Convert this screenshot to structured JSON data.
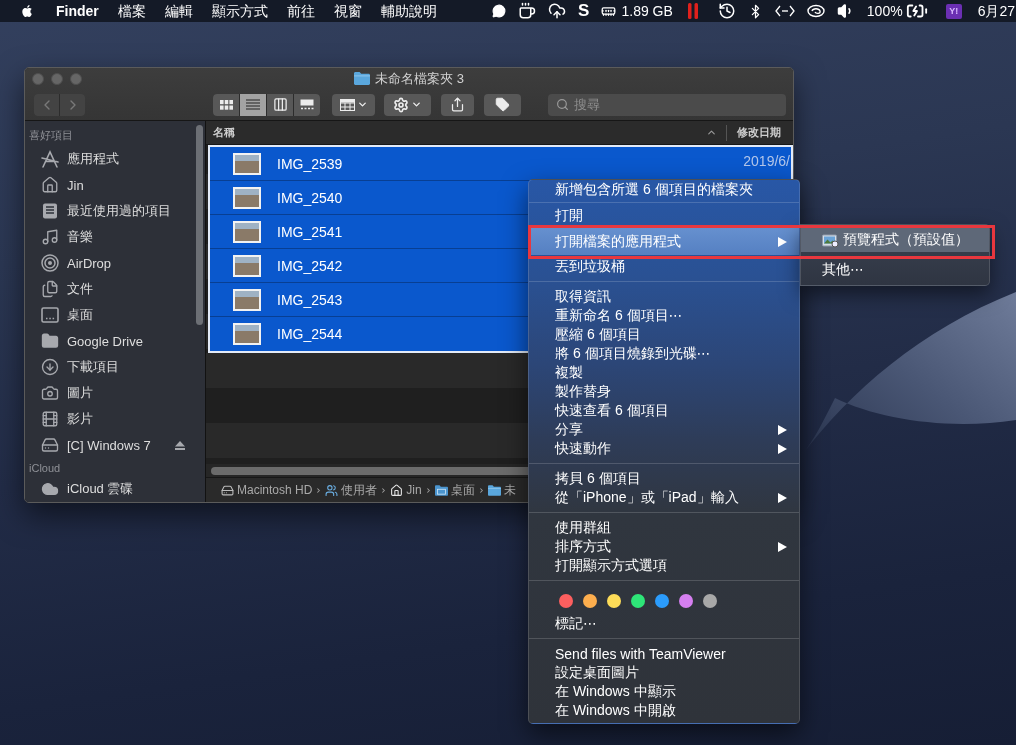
{
  "menu_bar": {
    "app_name": "Finder",
    "menus": [
      "檔案",
      "編輯",
      "顯示方式",
      "前往",
      "視窗",
      "輔助說明"
    ],
    "status": {
      "letter_logo": "S",
      "memory": "1.89 GB",
      "battery": "100%",
      "badge": "Y!",
      "date": "6月27"
    }
  },
  "finder_window": {
    "title": "未命名檔案夾 3",
    "navigation": [
      {
        "kind": "back",
        "disabled": true
      },
      {
        "kind": "forward",
        "disabled": true
      }
    ],
    "view_modes": [
      {
        "kind": "icon",
        "selected": false
      },
      {
        "kind": "list",
        "selected": true
      },
      {
        "kind": "column",
        "selected": false
      },
      {
        "kind": "gallery",
        "selected": false
      }
    ],
    "search": {
      "placeholder": "搜尋"
    },
    "sidebar": [
      {
        "title": "喜好項目",
        "items": [
          {
            "label": "應用程式",
            "kind": "apps",
            "ejectable": false
          },
          {
            "label": "Jin",
            "kind": "home",
            "ejectable": false
          },
          {
            "label": "最近使用過的項目",
            "kind": "recents",
            "ejectable": false
          },
          {
            "label": "音樂",
            "kind": "music",
            "ejectable": false
          },
          {
            "label": "AirDrop",
            "kind": "airdrop",
            "ejectable": false
          },
          {
            "label": "文件",
            "kind": "documents",
            "ejectable": false
          },
          {
            "label": "桌面",
            "kind": "desktop",
            "ejectable": false
          },
          {
            "label": "Google Drive",
            "kind": "folder",
            "ejectable": false
          },
          {
            "label": "下載項目",
            "kind": "downloads",
            "ejectable": false
          },
          {
            "label": "圖片",
            "kind": "pictures",
            "ejectable": false
          },
          {
            "label": "影片",
            "kind": "movies",
            "ejectable": false
          },
          {
            "label": "[C] Windows 7",
            "kind": "disk",
            "ejectable": true
          }
        ]
      },
      {
        "title": "iCloud",
        "items": [
          {
            "label": "iCloud 雲碟",
            "kind": "cloud",
            "ejectable": false
          }
        ]
      }
    ],
    "table": {
      "columns": [
        "名稱",
        "修改日期"
      ],
      "rows": [
        {
          "name": "IMG_2539",
          "date": "2019/6/",
          "selected": true
        },
        {
          "name": "IMG_2540",
          "selected": true
        },
        {
          "name": "IMG_2541",
          "selected": true
        },
        {
          "name": "IMG_2542",
          "selected": true
        },
        {
          "name": "IMG_2543",
          "selected": true
        },
        {
          "name": "IMG_2544",
          "selected": true
        }
      ]
    },
    "path_bar": [
      {
        "label": "Macintosh HD",
        "kind": "disk"
      },
      {
        "label": "使用者",
        "kind": "users"
      },
      {
        "label": "Jin",
        "kind": "home"
      },
      {
        "label": "桌面",
        "kind": "desktop"
      },
      {
        "label": "未",
        "kind": "folder"
      }
    ]
  },
  "context_menu": {
    "groups": [
      {
        "kind": "items",
        "items": [
          {
            "label": "新增包含所選 6 個項目的檔案夾",
            "submenu": false,
            "selected": false
          }
        ]
      },
      {
        "kind": "items",
        "items": [
          {
            "label": "打開",
            "submenu": false,
            "selected": false
          },
          {
            "label": "打開檔案的應用程式",
            "submenu": true,
            "selected": true
          },
          {
            "label": "丟到垃圾桶",
            "submenu": false,
            "selected": false
          }
        ]
      },
      {
        "kind": "items",
        "items": [
          {
            "label": "取得資訊",
            "submenu": false,
            "selected": false
          },
          {
            "label": "重新命名 6 個項目⋯",
            "submenu": false,
            "selected": false
          },
          {
            "label": "壓縮 6 個項目",
            "submenu": false,
            "selected": false
          },
          {
            "label": "將 6 個項目燒錄到光碟⋯",
            "submenu": false,
            "selected": false
          },
          {
            "label": "複製",
            "submenu": false,
            "selected": false
          },
          {
            "label": "製作替身",
            "submenu": false,
            "selected": false
          },
          {
            "label": "快速查看 6 個項目",
            "submenu": false,
            "selected": false
          },
          {
            "label": "分享",
            "submenu": true,
            "selected": false
          },
          {
            "label": "快速動作",
            "submenu": true,
            "selected": false
          }
        ]
      },
      {
        "kind": "items",
        "items": [
          {
            "label": "拷貝 6 個項目",
            "submenu": false,
            "selected": false
          },
          {
            "label": "從「iPhone」或「iPad」輸入",
            "submenu": true,
            "selected": false
          }
        ]
      },
      {
        "kind": "items",
        "items": [
          {
            "label": "使用群組",
            "submenu": false,
            "selected": false
          },
          {
            "label": "排序方式",
            "submenu": true,
            "selected": false
          },
          {
            "label": "打開顯示方式選項",
            "submenu": false,
            "selected": false
          }
        ]
      },
      {
        "kind": "tags",
        "tags": [
          {
            "color": "#fc5f5f"
          },
          {
            "color": "#fdae4e"
          },
          {
            "color": "#fddc58"
          },
          {
            "color": "#2ee578"
          },
          {
            "color": "#2b9cfc"
          },
          {
            "color": "#d57ff0"
          },
          {
            "color": "#a8a8a8"
          }
        ],
        "label": "標記⋯"
      },
      {
        "kind": "items",
        "items": [
          {
            "label": "Send files with TeamViewer",
            "submenu": false,
            "selected": false
          },
          {
            "label": "設定桌面圖片",
            "submenu": false,
            "selected": false
          },
          {
            "label": "在 Windows 中顯示",
            "submenu": false,
            "selected": false
          },
          {
            "label": "在 Windows 中開啟",
            "submenu": false,
            "selected": false
          }
        ]
      }
    ]
  },
  "submenu": {
    "items": [
      {
        "label": "預覽程式（預設值）",
        "kind": "app",
        "selected": true
      },
      {
        "label": "其他⋯",
        "kind": "plain",
        "selected": false
      }
    ]
  }
}
